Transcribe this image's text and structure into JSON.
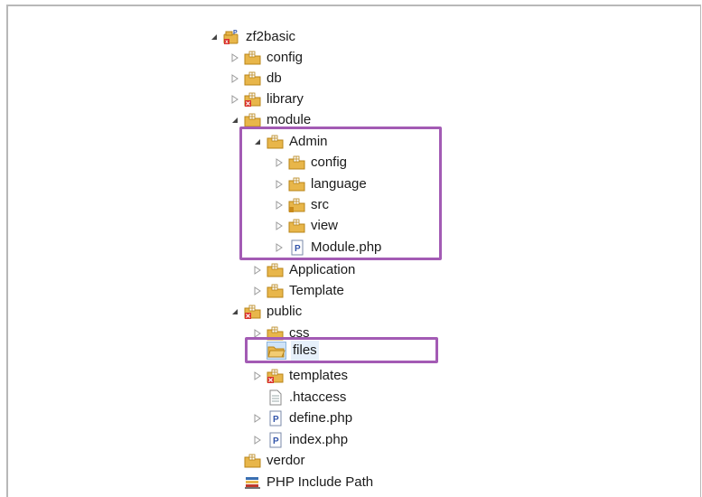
{
  "colors": {
    "highlight": "#a35bb4",
    "folder": "#e8b64a",
    "folder_dark": "#b88418",
    "error": "#d9302a",
    "arrow": "#9a9a9a",
    "expanded_arrow": "#444444"
  },
  "tree": {
    "project": "zf2basic",
    "config": "config",
    "db": "db",
    "library": "library",
    "module": "module",
    "admin": "Admin",
    "admin_config": "config",
    "admin_language": "language",
    "admin_src": "src",
    "admin_view": "view",
    "admin_module_php": "Module.php",
    "application": "Application",
    "template": "Template",
    "public": "public",
    "css": "css",
    "files": "files",
    "templates": "templates",
    "htaccess": ".htaccess",
    "define_php": "define.php",
    "index_php": "index.php",
    "verdor": "verdor",
    "include_path": "PHP Include Path"
  },
  "icons": {
    "project": "php-project-icon",
    "folder": "package-folder-icon",
    "error_folder": "folder-error-icon",
    "php_file": "php-file-icon",
    "text_file": "text-file-icon",
    "include_path": "include-path-icon"
  }
}
